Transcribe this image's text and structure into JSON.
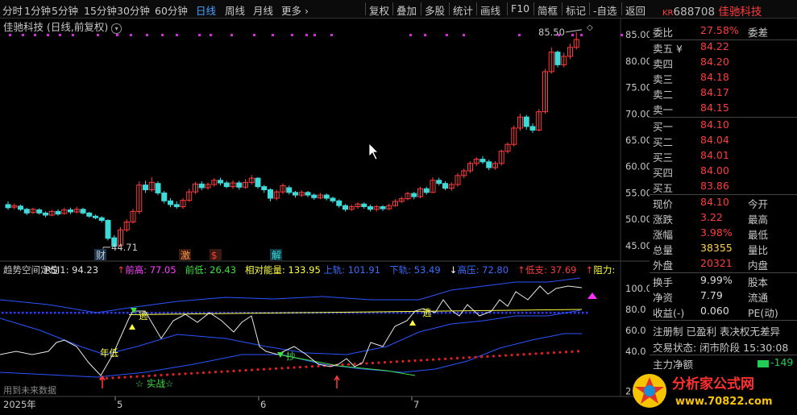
{
  "toolbar": {
    "periods": [
      "分时",
      "1分钟",
      "5分钟",
      "15分钟",
      "30分钟",
      "60分钟",
      "日线",
      "周线",
      "月线",
      "更多 ›"
    ],
    "active_period": "日线",
    "tools": [
      "复权",
      "叠加",
      "多股",
      "统计",
      "画线",
      "F10",
      "简框",
      "标记",
      "-自选",
      "返回"
    ]
  },
  "stock": {
    "prefix": "KR",
    "code": "688708",
    "name": "佳驰科技"
  },
  "chart_title": "佳驰科技 (日线,前复权)",
  "price_axis": [
    "85.00",
    "80.00",
    "75.00",
    "70.00",
    "65.00",
    "60.00",
    "55.00",
    "50.00",
    "45.00"
  ],
  "indicator_axis": [
    "100.0",
    "80.0",
    "60.0",
    "40.0",
    "2"
  ],
  "x_labels": [
    "2025年",
    "5",
    "6",
    "7"
  ],
  "price_annotations": {
    "high": "85.50",
    "low": "44.71"
  },
  "event_marks": [
    "财",
    "激",
    "$",
    "解"
  ],
  "indicator_header": [
    {
      "text": "趋势空间定位",
      "color": "#c8c8c8"
    },
    {
      "text": "RSI1: 94.23",
      "color": "#e0e0e0"
    },
    {
      "text": "↑",
      "color": "#ff3c3c"
    },
    {
      "text": "前高: 77.05",
      "color": "#ff40ff"
    },
    {
      "text": "前低: 26.43",
      "color": "#40e040"
    },
    {
      "text": "相对能量: 133.95",
      "color": "#ffff40"
    },
    {
      "text": "上轨: 101.91",
      "color": "#3a6cff"
    },
    {
      "text": "下轨: 53.49",
      "color": "#3a6cff"
    },
    {
      "text": "↓",
      "color": "#ffffff"
    },
    {
      "text": "高压: 72.80",
      "color": "#3a6cff"
    },
    {
      "text": "↑",
      "color": "#ff3c3c"
    },
    {
      "text": "低支: 37.69",
      "color": "#ff3c3c"
    },
    {
      "text": "↑",
      "color": "#ff3c3c"
    },
    {
      "text": "阻力:",
      "color": "#ffff40"
    }
  ],
  "indicator_labels": {
    "escape1": "逃",
    "escape2": "逃",
    "year_low": "年低",
    "buy": "抄",
    "combat": "☆ 实战☆",
    "future": "用到未来数据"
  },
  "quote": {
    "webi": {
      "label": "委比",
      "value": "27.58%",
      "label2": "委差"
    },
    "asks": [
      {
        "label": "卖五 ¥",
        "price": "84.22"
      },
      {
        "label": "卖四",
        "price": "84.20"
      },
      {
        "label": "卖三",
        "price": "84.18"
      },
      {
        "label": "卖二",
        "price": "84.17"
      },
      {
        "label": "卖一",
        "price": "84.15"
      }
    ],
    "bids": [
      {
        "label": "买一",
        "price": "84.10"
      },
      {
        "label": "买二",
        "price": "84.04"
      },
      {
        "label": "买三",
        "price": "84.01"
      },
      {
        "label": "买四",
        "price": "84.00"
      },
      {
        "label": "买五",
        "price": "83.86"
      }
    ],
    "stats": [
      {
        "l": "现价",
        "v": "84.10",
        "l2": "今开",
        "c": "red"
      },
      {
        "l": "涨跌",
        "v": "3.22",
        "l2": "最高",
        "c": "red"
      },
      {
        "l": "涨幅",
        "v": "3.98%",
        "l2": "最低",
        "c": "red"
      },
      {
        "l": "总量",
        "v": "38355",
        "l2": "量比",
        "c": "yellow"
      },
      {
        "l": "外盘",
        "v": "20321",
        "l2": "内盘",
        "c": "red"
      }
    ],
    "stats2": [
      {
        "l": "换手",
        "v": "9.99%",
        "l2": "股本"
      },
      {
        "l": "净资",
        "v": "7.79",
        "l2": "流通"
      },
      {
        "l": "收益(-)",
        "v": "0.060",
        "l2": "PE(动)"
      }
    ],
    "reg": "注册制 已盈利 表决权无差异",
    "trade_status": "交易状态: 闭市阶段 15:30:08",
    "main_flow": {
      "label": "主力净额",
      "value": "-149"
    }
  },
  "watermark": {
    "text1": "分析家公式网",
    "text2": "www.70822.com"
  },
  "chart_data": {
    "type": "candlestick",
    "ylim": [
      43,
      87
    ],
    "candles": [
      [
        52.8,
        52.2,
        53.4,
        51.8
      ],
      [
        52.3,
        52.6,
        53.0,
        51.9
      ],
      [
        52.5,
        51.9,
        52.8,
        51.6
      ],
      [
        51.9,
        51.2,
        52.2,
        50.8
      ],
      [
        51.3,
        51.9,
        52.2,
        51.0
      ],
      [
        51.8,
        51.2,
        52.1,
        50.9
      ],
      [
        51.2,
        50.8,
        51.5,
        50.4
      ],
      [
        50.8,
        51.5,
        51.8,
        50.6
      ],
      [
        51.5,
        51.0,
        51.9,
        50.7
      ],
      [
        51.1,
        51.8,
        52.2,
        50.9
      ],
      [
        51.8,
        51.4,
        52.2,
        51.0
      ],
      [
        51.4,
        51.9,
        52.4,
        51.1
      ],
      [
        51.9,
        51.2,
        52.2,
        50.9
      ],
      [
        51.2,
        50.6,
        51.4,
        50.3
      ],
      [
        50.6,
        50.3,
        50.9,
        50.0
      ],
      [
        50.3,
        49.8,
        50.6,
        49.4
      ],
      [
        49.8,
        46.4,
        50.0,
        46.0
      ],
      [
        46.5,
        44.9,
        47.0,
        44.71
      ],
      [
        45.0,
        48.0,
        48.5,
        44.9
      ],
      [
        48.0,
        49.5,
        50.0,
        47.6
      ],
      [
        49.5,
        51.5,
        52.0,
        49.2
      ],
      [
        51.5,
        56.5,
        57.2,
        51.0
      ],
      [
        56.5,
        55.6,
        57.3,
        55.0
      ],
      [
        55.6,
        57.0,
        58.0,
        55.2
      ],
      [
        56.8,
        55.0,
        57.2,
        54.6
      ],
      [
        55.0,
        53.5,
        55.4,
        53.0
      ],
      [
        53.5,
        52.8,
        54.0,
        52.3
      ],
      [
        52.8,
        52.4,
        53.4,
        52.0
      ],
      [
        52.4,
        53.6,
        54.0,
        52.0
      ],
      [
        53.6,
        55.2,
        55.8,
        53.3
      ],
      [
        55.2,
        56.7,
        57.1,
        54.8
      ],
      [
        56.7,
        56.0,
        57.2,
        55.5
      ],
      [
        56.0,
        56.6,
        57.0,
        55.6
      ],
      [
        56.6,
        57.4,
        57.8,
        56.2
      ],
      [
        57.4,
        56.9,
        57.9,
        56.4
      ],
      [
        56.9,
        56.2,
        57.3,
        55.9
      ],
      [
        56.2,
        56.9,
        57.4,
        55.8
      ],
      [
        56.9,
        56.1,
        57.3,
        55.6
      ],
      [
        56.1,
        57.0,
        57.6,
        55.8
      ],
      [
        57.0,
        57.8,
        58.4,
        56.6
      ],
      [
        57.8,
        56.2,
        58.0,
        55.8
      ],
      [
        56.2,
        55.6,
        56.5,
        55.0
      ],
      [
        55.6,
        54.0,
        55.9,
        53.4
      ],
      [
        54.0,
        55.2,
        55.6,
        53.6
      ],
      [
        55.2,
        56.4,
        56.8,
        54.8
      ],
      [
        56.0,
        55.1,
        56.4,
        54.7
      ],
      [
        55.1,
        54.6,
        55.4,
        54.1
      ],
      [
        54.6,
        55.1,
        55.5,
        54.2
      ],
      [
        55.1,
        54.6,
        55.4,
        54.2
      ],
      [
        54.6,
        54.1,
        54.9,
        53.7
      ],
      [
        54.1,
        54.6,
        55.0,
        53.8
      ],
      [
        54.6,
        54.0,
        54.9,
        53.6
      ],
      [
        54.0,
        53.5,
        54.3,
        53.1
      ],
      [
        53.5,
        52.6,
        53.8,
        52.2
      ],
      [
        52.6,
        51.9,
        52.9,
        51.5
      ],
      [
        51.9,
        52.4,
        52.8,
        51.6
      ],
      [
        52.4,
        52.9,
        53.2,
        52.0
      ],
      [
        52.9,
        52.4,
        53.2,
        52.0
      ],
      [
        52.4,
        51.9,
        52.8,
        51.5
      ],
      [
        51.9,
        52.4,
        52.7,
        51.5
      ],
      [
        52.4,
        52.0,
        52.7,
        51.6
      ],
      [
        52.0,
        52.6,
        53.0,
        51.7
      ],
      [
        52.6,
        53.4,
        53.8,
        52.4
      ],
      [
        53.4,
        53.9,
        54.3,
        53.1
      ],
      [
        53.9,
        54.9,
        55.2,
        53.6
      ],
      [
        54.9,
        54.3,
        55.2,
        53.8
      ],
      [
        54.3,
        55.8,
        56.2,
        54.0
      ],
      [
        55.8,
        55.1,
        56.2,
        54.7
      ],
      [
        55.1,
        57.4,
        58.0,
        55.0
      ],
      [
        57.4,
        56.8,
        57.9,
        56.4
      ],
      [
        56.8,
        55.9,
        57.2,
        55.5
      ],
      [
        55.9,
        56.6,
        57.0,
        55.4
      ],
      [
        56.6,
        58.3,
        58.8,
        56.2
      ],
      [
        58.3,
        59.2,
        59.6,
        57.8
      ],
      [
        59.2,
        60.6,
        61.0,
        58.8
      ],
      [
        60.6,
        61.4,
        61.8,
        60.1
      ],
      [
        61.4,
        60.9,
        62.0,
        60.5
      ],
      [
        60.9,
        59.8,
        61.3,
        59.3
      ],
      [
        59.8,
        60.6,
        61.0,
        59.4
      ],
      [
        60.6,
        62.9,
        63.2,
        60.2
      ],
      [
        62.9,
        64.2,
        64.6,
        62.5
      ],
      [
        64.2,
        67.3,
        67.8,
        63.8
      ],
      [
        67.3,
        69.4,
        70.0,
        66.8
      ],
      [
        69.4,
        67.6,
        69.8,
        67.0
      ],
      [
        67.6,
        66.9,
        68.2,
        66.4
      ],
      [
        66.9,
        70.4,
        70.9,
        66.7
      ],
      [
        70.4,
        78.0,
        78.5,
        70.0
      ],
      [
        78.0,
        81.7,
        82.6,
        77.6
      ],
      [
        81.7,
        79.3,
        82.0,
        78.8
      ],
      [
        79.3,
        80.9,
        81.6,
        78.8
      ],
      [
        80.9,
        82.6,
        83.3,
        80.4
      ],
      [
        82.6,
        84.1,
        85.5,
        82.2
      ]
    ]
  }
}
